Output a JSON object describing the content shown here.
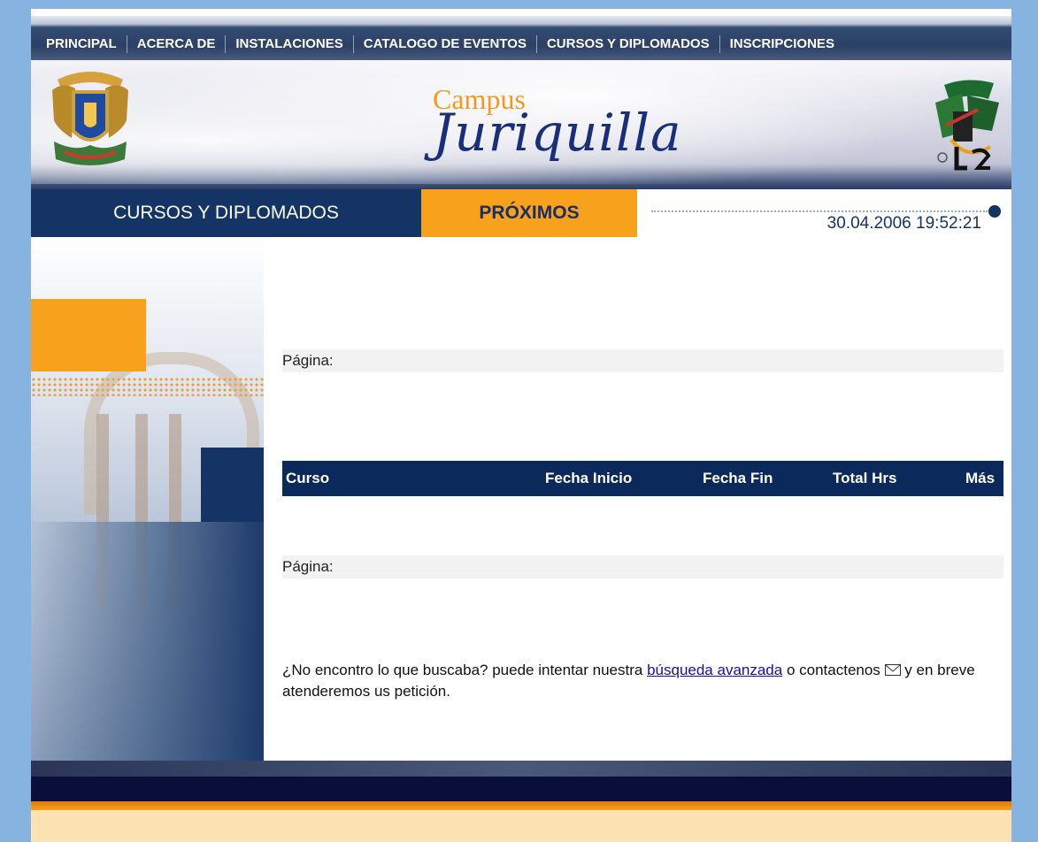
{
  "nav": {
    "items": [
      "PRINCIPAL",
      "ACERCA DE",
      "INSTALACIONES",
      "CATALOGO DE EVENTOS",
      "CURSOS Y DIPLOMADOS",
      "INSCRIPCIONES"
    ]
  },
  "banner": {
    "campus": "Campus",
    "juriquilla": "Juriquilla"
  },
  "section": {
    "title": "CURSOS Y DIPLOMADOS",
    "tab": "PRÓXIMOS",
    "datetime": "30.04.2006 19:52:21"
  },
  "pager": {
    "top_label": "Página:",
    "bottom_label": "Página:"
  },
  "table": {
    "columns": [
      "Curso",
      "Fecha Inicio",
      "Fecha Fin",
      "Total Hrs",
      "Más"
    ]
  },
  "notice": {
    "before_link": "¿No encontro lo que buscaba? puede intentar nuestra",
    "link": "búsqueda avanzada",
    "after_link": "o contactenos",
    "after_icon": "y en breve atenderemos us petición.",
    "icon": "envelope-icon"
  },
  "colors": {
    "navy": "#143466",
    "orange": "#f7a11c",
    "page_bg": "#87b3e0"
  }
}
